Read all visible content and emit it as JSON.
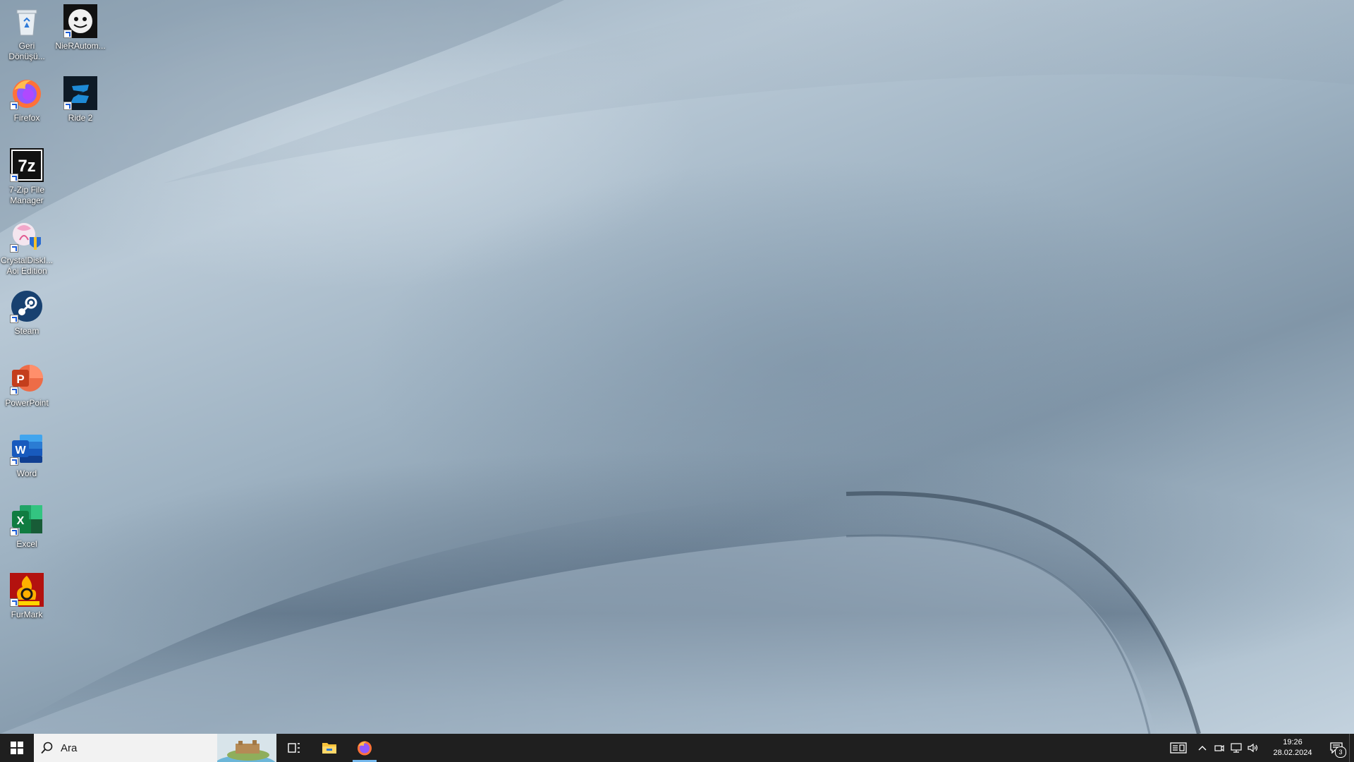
{
  "desktop": {
    "icons": [
      {
        "label": "Geri Dönüşü...",
        "icon": "recycle-bin-icon"
      },
      {
        "label": "NieRAutom...",
        "icon": "nier-automata-icon"
      },
      {
        "label": "Firefox",
        "icon": "firefox-icon"
      },
      {
        "label": "Ride 2",
        "icon": "ride2-icon"
      },
      {
        "label": "7-Zip File Manager",
        "icon": "7zip-icon",
        "glyph": "7z"
      },
      {
        "label": "CrystalDiskI... Aoi Edition",
        "icon": "crystaldiskinfo-icon"
      },
      {
        "label": "Steam",
        "icon": "steam-icon"
      },
      {
        "label": "PowerPoint",
        "icon": "powerpoint-icon",
        "glyph": "P"
      },
      {
        "label": "Word",
        "icon": "word-icon",
        "glyph": "W"
      },
      {
        "label": "Excel",
        "icon": "excel-icon",
        "glyph": "X"
      },
      {
        "label": "FurMark",
        "icon": "furmark-icon"
      }
    ]
  },
  "taskbar": {
    "search_placeholder": "Ara",
    "pinned": [
      {
        "name": "task-view",
        "icon": "task-view-icon"
      },
      {
        "name": "file-explorer",
        "icon": "folder-icon"
      },
      {
        "name": "firefox",
        "icon": "firefox-icon",
        "active": true
      }
    ],
    "tray": {
      "time": "19:26",
      "date": "28.02.2024",
      "notification_count": "3"
    }
  },
  "colors": {
    "taskbar_bg": "#1f1f1f",
    "active_indicator": "#76b9ed",
    "search_bg": "#f2f2f2"
  }
}
